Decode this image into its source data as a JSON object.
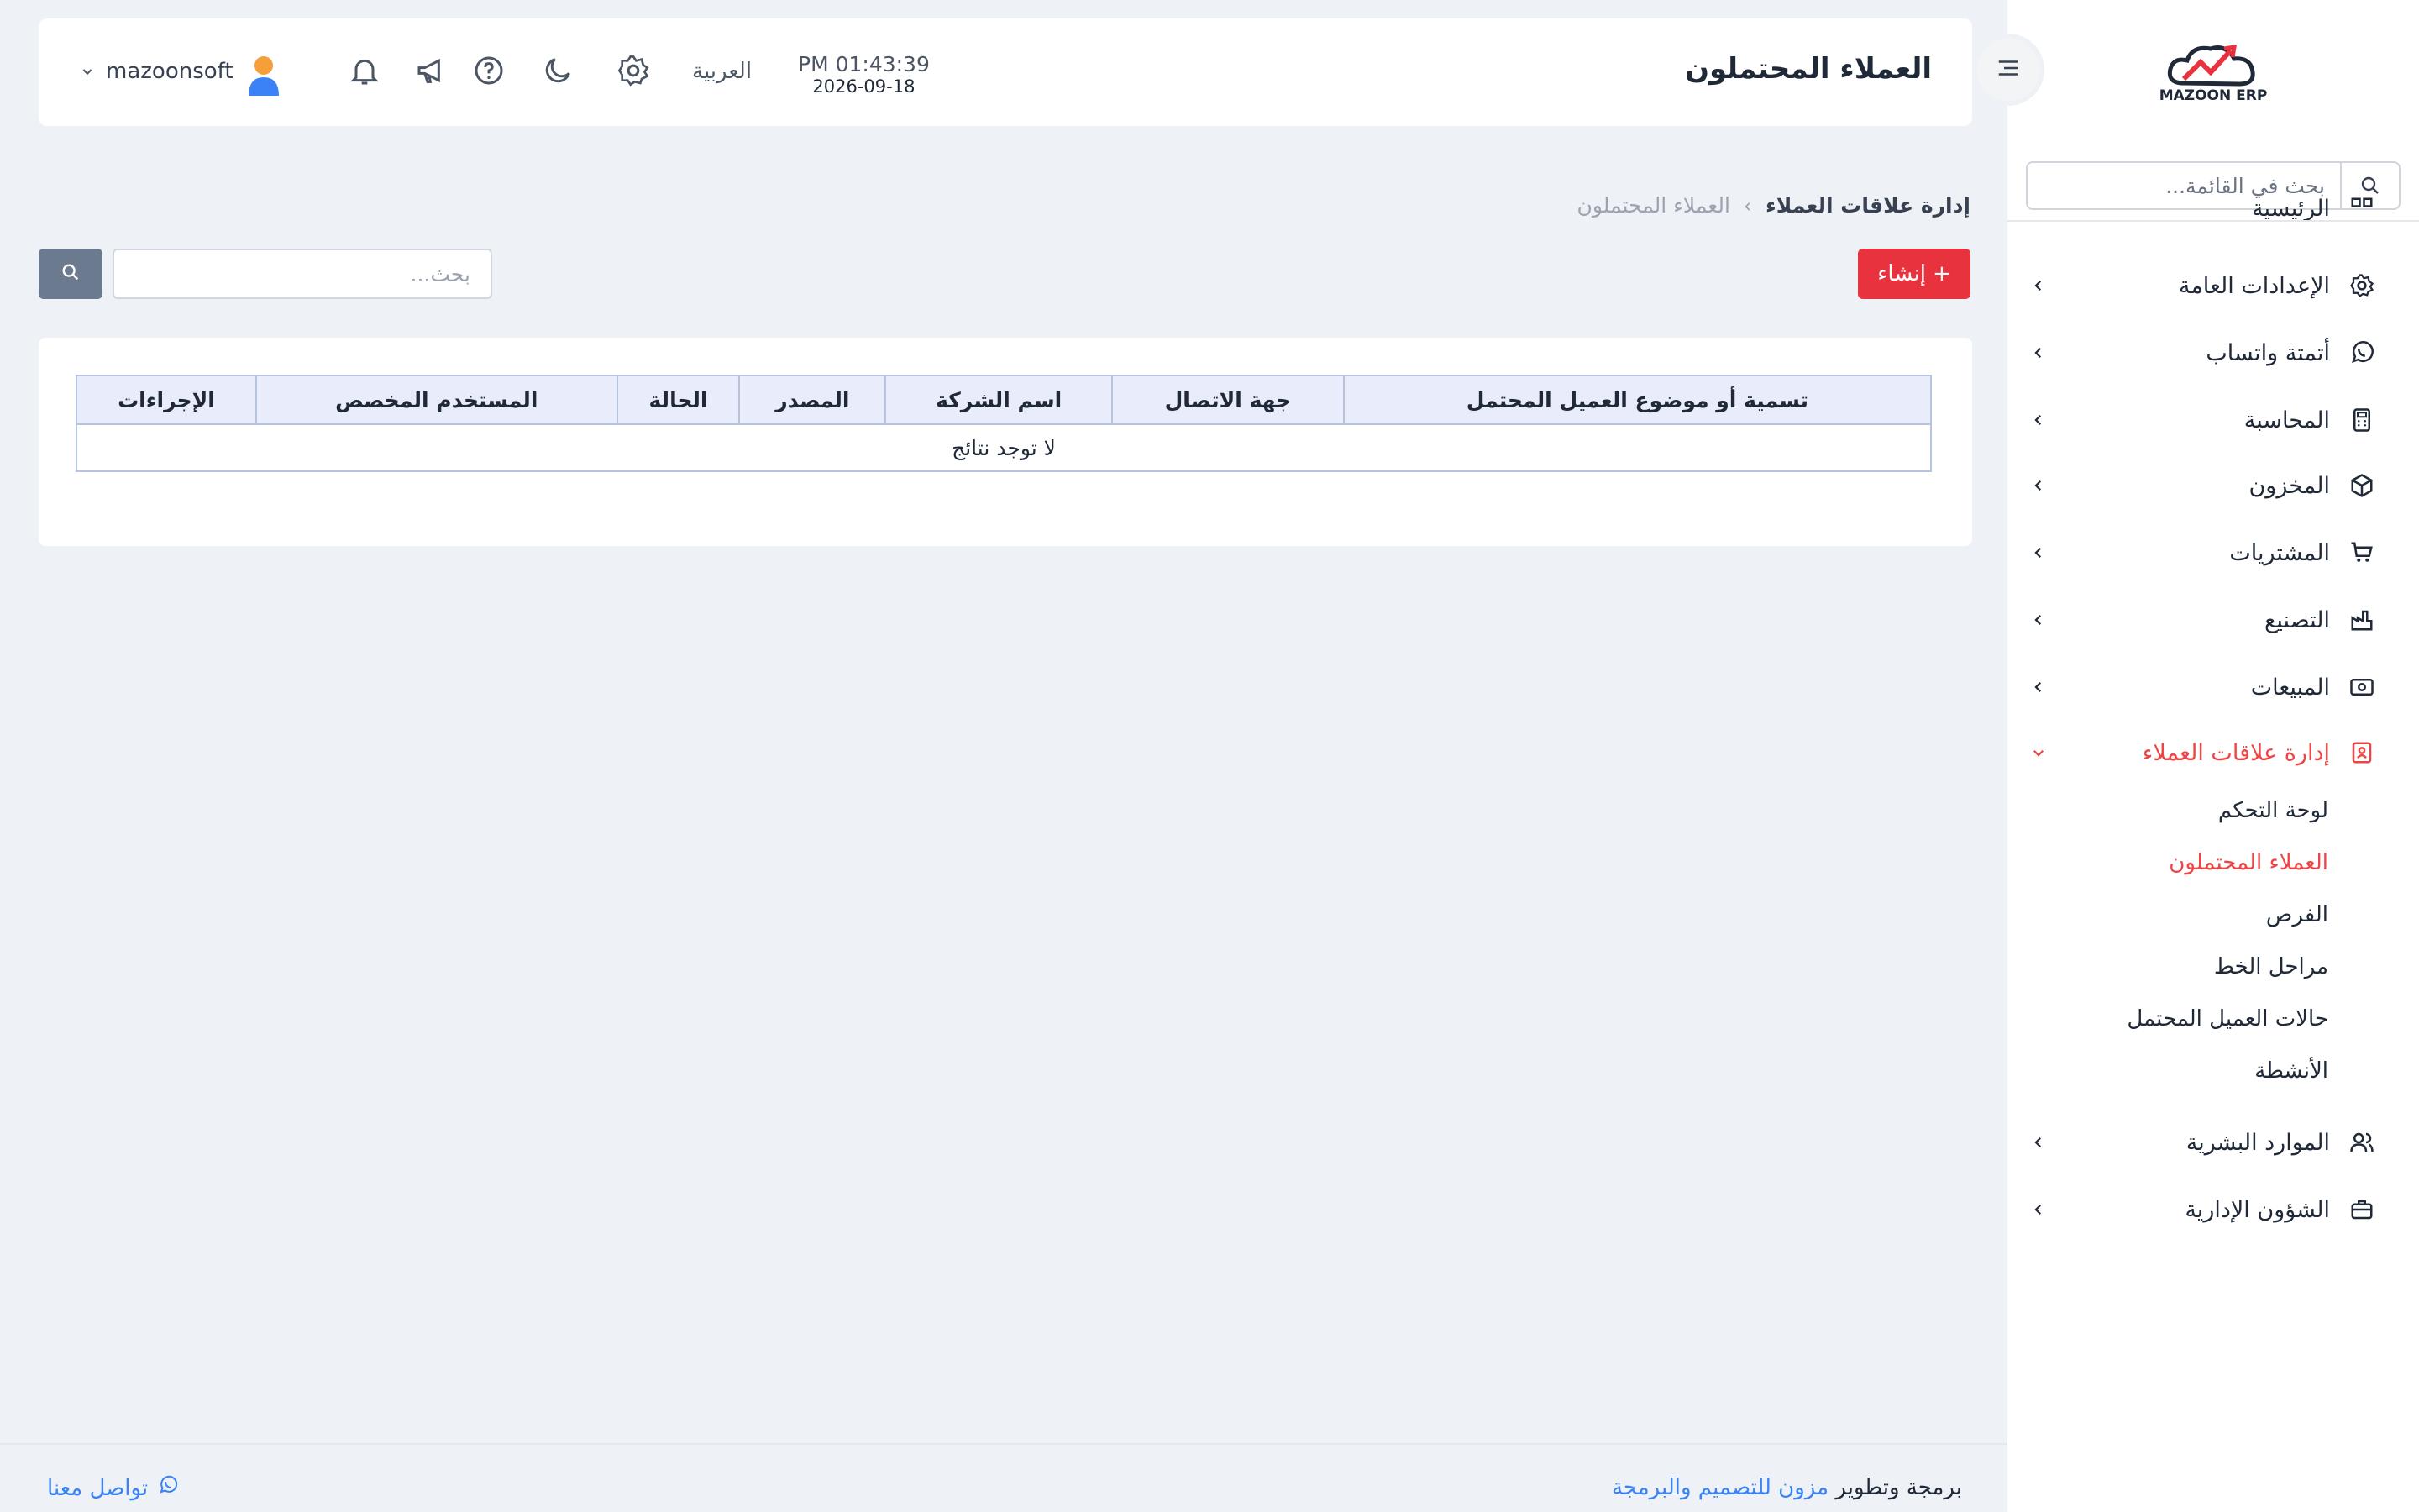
{
  "sidebar": {
    "logo_text": "MAZOON ERP",
    "search_placeholder": "بحث في القائمة...",
    "partial_item": "الرئيسية",
    "items": [
      {
        "label": "الإعدادات العامة",
        "icon": "gear-icon"
      },
      {
        "label": "أتمتة واتساب",
        "icon": "whatsapp-icon"
      },
      {
        "label": "المحاسبة",
        "icon": "calculator-icon"
      },
      {
        "label": "المخزون",
        "icon": "box-icon"
      },
      {
        "label": "المشتريات",
        "icon": "cart-icon"
      },
      {
        "label": "التصنيع",
        "icon": "factory-icon"
      },
      {
        "label": "المبيعات",
        "icon": "cash-icon"
      },
      {
        "label": "إدارة علاقات العملاء",
        "icon": "contacts-icon",
        "active": true
      },
      {
        "label": "الموارد البشرية",
        "icon": "users-icon"
      },
      {
        "label": "الشؤون الإدارية",
        "icon": "briefcase-icon"
      }
    ],
    "crm_sub_items": [
      {
        "label": "لوحة التحكم"
      },
      {
        "label": "العملاء المحتملون",
        "active": true
      },
      {
        "label": "الفرص"
      },
      {
        "label": "مراحل الخط"
      },
      {
        "label": "حالات العميل المحتمل"
      },
      {
        "label": "الأنشطة"
      }
    ]
  },
  "header": {
    "title": "العملاء المحتملون",
    "time": "PM 01:43:39",
    "date": "2026-09-18",
    "language": "العربية",
    "username": "mazoonsoft"
  },
  "breadcrumb": {
    "parent": "إدارة علاقات العملاء",
    "current": "العملاء المحتملون"
  },
  "toolbar": {
    "create_label": "إنشاء",
    "search_placeholder": "بحث..."
  },
  "table": {
    "columns": [
      "تسمية أو موضوع العميل المحتمل",
      "جهة الاتصال",
      "اسم الشركة",
      "المصدر",
      "الحالة",
      "المستخدم المخصص",
      "الإجراءات"
    ],
    "empty_text": "لا توجد نتائج"
  },
  "footer": {
    "credit_prefix": "برمجة وتطوير",
    "credit_link": "مزون للتصميم والبرمجة",
    "contact": "تواصل معنا"
  },
  "colors": {
    "accent": "#e8333f",
    "link": "#3b82f6",
    "background": "#eef2f6"
  }
}
